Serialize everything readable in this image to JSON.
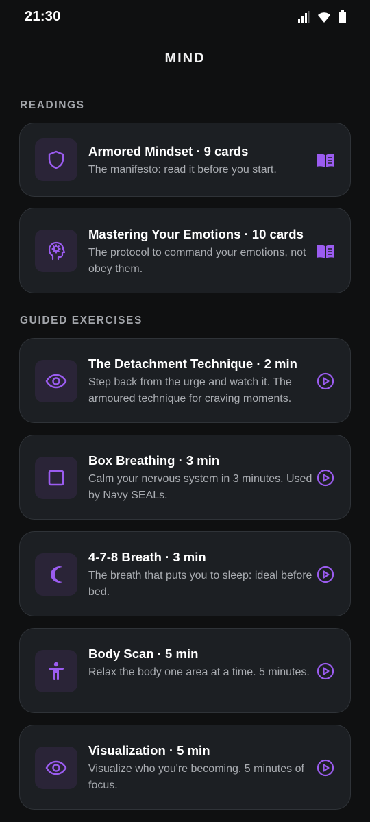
{
  "status": {
    "time": "21:30"
  },
  "header": {
    "title": "MIND"
  },
  "readings": {
    "section_title": "READINGS",
    "items": [
      {
        "title": "Armored Mindset · 9 cards",
        "subtitle": "The manifesto: read it before you start.",
        "icon": "shield-icon",
        "action_icon": "book-icon"
      },
      {
        "title": "Mastering Your Emotions · 10 cards",
        "subtitle": "The protocol to command your emotions, not obey them.",
        "icon": "brain-head-icon",
        "action_icon": "book-icon"
      }
    ]
  },
  "exercises": {
    "section_title": "GUIDED EXERCISES",
    "items": [
      {
        "title": "The Detachment Technique · 2 min",
        "subtitle": "Step back from the urge and watch it. The armoured technique for craving moments.",
        "icon": "eye-icon",
        "action_icon": "play-icon"
      },
      {
        "title": "Box Breathing · 3 min",
        "subtitle": "Calm your nervous system in 3 minutes. Used by Navy SEALs.",
        "icon": "square-icon",
        "action_icon": "play-icon"
      },
      {
        "title": "4-7-8 Breath · 3 min",
        "subtitle": "The breath that puts you to sleep: ideal before bed.",
        "icon": "moon-icon",
        "action_icon": "play-icon"
      },
      {
        "title": "Body Scan · 5 min",
        "subtitle": "Relax the body one area at a time. 5 minutes.",
        "icon": "person-icon",
        "action_icon": "play-icon"
      },
      {
        "title": "Visualization · 5 min",
        "subtitle": "Visualize who you're becoming. 5 minutes of focus.",
        "icon": "eye-icon",
        "action_icon": "play-icon"
      }
    ]
  },
  "colors": {
    "accent": "#9b5cf0",
    "card_bg": "#1c1f23",
    "icon_bg": "#2a2437",
    "background": "#0f1011"
  }
}
